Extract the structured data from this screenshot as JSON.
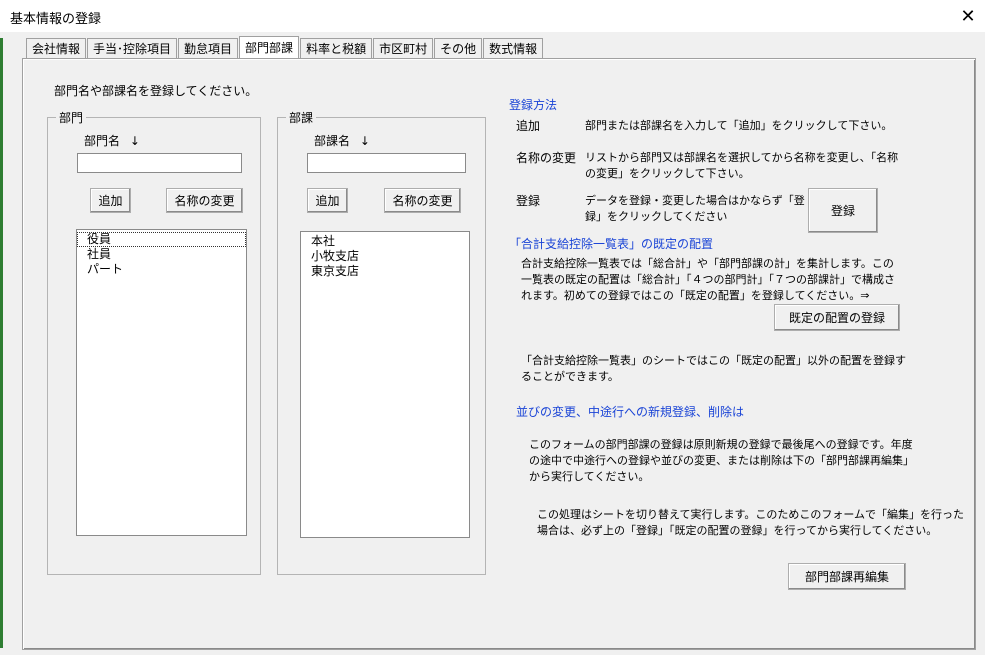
{
  "window": {
    "title": "基本情報の登録",
    "close_symbol": "✕"
  },
  "tabs": [
    {
      "label": "会社情報",
      "active": false
    },
    {
      "label": "手当･控除項目",
      "active": false
    },
    {
      "label": "勤怠項目",
      "active": false
    },
    {
      "label": "部門部課",
      "active": true
    },
    {
      "label": "料率と税額",
      "active": false
    },
    {
      "label": "市区町村",
      "active": false
    },
    {
      "label": "その他",
      "active": false
    },
    {
      "label": "数式情報",
      "active": false
    }
  ],
  "instruction": "部門名や部課名を登録してください。",
  "dept": {
    "group_label": "部門",
    "field_label": "部門名",
    "arrow": "↓",
    "input_value": "",
    "add_button": "追加",
    "rename_button": "名称の変更",
    "items": [
      "役員",
      "社員",
      "パート"
    ]
  },
  "section": {
    "group_label": "部課",
    "field_label": "部課名",
    "arrow": "↓",
    "input_value": "",
    "add_button": "追加",
    "rename_button": "名称の変更",
    "items": [
      "本社",
      "小牧支店",
      "東京支店"
    ]
  },
  "help": {
    "register_method_heading": "登録方法",
    "add_term": "追加",
    "add_desc": "部門または部課名を入力して「追加」をクリックして下さい。",
    "rename_term": "名称の変更",
    "rename_desc_1": "リストから部門又は部課名を選択してから名称を変更し、「名称",
    "rename_desc_2": "の変更」をクリックして下さい。",
    "register_term": "登録",
    "register_desc_1": "データを登録・変更した場合はかならず「登",
    "register_desc_2": "録」をクリックしてください",
    "register_button": "登録",
    "default_heading": "「合計支給控除一覧表」の既定の配置",
    "default_desc_1": "合計支給控除一覧表では「総合計」や「部門部課の計」を集計します。この",
    "default_desc_2": "一覧表の既定の配置は「総合計」「４つの部門計」「７つの部課計」で構成さ",
    "default_desc_3": "れます。初めての登録ではこの「既定の配置」を登録してください。⇒",
    "default_button": "既定の配置の登録",
    "sheet_desc_1": "「合計支給控除一覧表」のシートではこの「既定の配置」以外の配置を登録す",
    "sheet_desc_2": "ることができます。",
    "reorder_heading": "並びの変更、中途行への新規登録、削除は",
    "reorder_desc_1": "このフォームの部門部課の登録は原則新規の登録で最後尾への登録です。年度",
    "reorder_desc_2": "の途中で中途行への登録や並びの変更、または削除は下の「部門部課再編集」",
    "reorder_desc_3": "から実行してください。",
    "switch_desc_1": "この処理はシートを切り替えて実行します。このためこのフォームで「編集」を行った",
    "switch_desc_2": "場合は、必ず上の「登録」「既定の配置の登録」を行ってから実行してください。",
    "reedit_button": "部門部課再編集"
  }
}
